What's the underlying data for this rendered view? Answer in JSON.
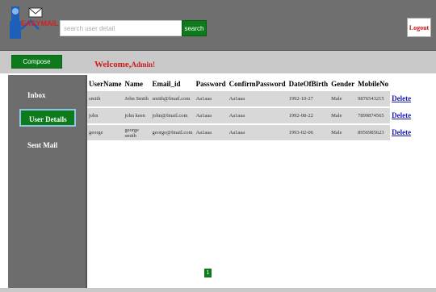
{
  "header": {
    "logo_text": "EASYMAIL",
    "search": {
      "placeholder": "search user detail",
      "button_label": "search"
    },
    "logout_label": "Logout"
  },
  "subbar": {
    "compose_label": "Compose",
    "welcome_text": "Welcome,",
    "welcome_user": "Admin!"
  },
  "sidebar": {
    "items": [
      {
        "label": "Inbox"
      },
      {
        "label": "User Details",
        "active": true
      },
      {
        "label": "Sent Mail"
      }
    ]
  },
  "table": {
    "columns": [
      "UserName",
      "Name",
      "Email_id",
      "Password",
      "ConfirmPassword",
      "DateOfBirth",
      "Gender",
      "MobileNo"
    ],
    "rows": [
      {
        "username": "smith",
        "name": "John Smith",
        "email": "smith@fmail.com",
        "password": "Aa1aaa",
        "confirm": "Aa1aaa",
        "dob": "1992-10-27",
        "gender": "Male",
        "mobile": "9876543215",
        "action": "Delete"
      },
      {
        "username": "john",
        "name": "john keen",
        "email": "john@fmail.com",
        "password": "Aa1aaa",
        "confirm": "Aa1aaa",
        "dob": "1992-08-22",
        "gender": "Male",
        "mobile": "7899874565",
        "action": "Delete"
      },
      {
        "username": "george",
        "name": "george smith",
        "email": "george@fmail.com",
        "password": "Aa1aaa",
        "confirm": "Aa1aaa",
        "dob": "1993-02-06",
        "gender": "Male",
        "mobile": "8956985623",
        "action": "Delete"
      }
    ]
  },
  "pagination": {
    "current": "1"
  },
  "colors": {
    "accent_green": "#0d7a1c",
    "header_gray": "#6f6f6f",
    "welcome_red": "#d01818",
    "link_blue": "#1a1ab0"
  }
}
